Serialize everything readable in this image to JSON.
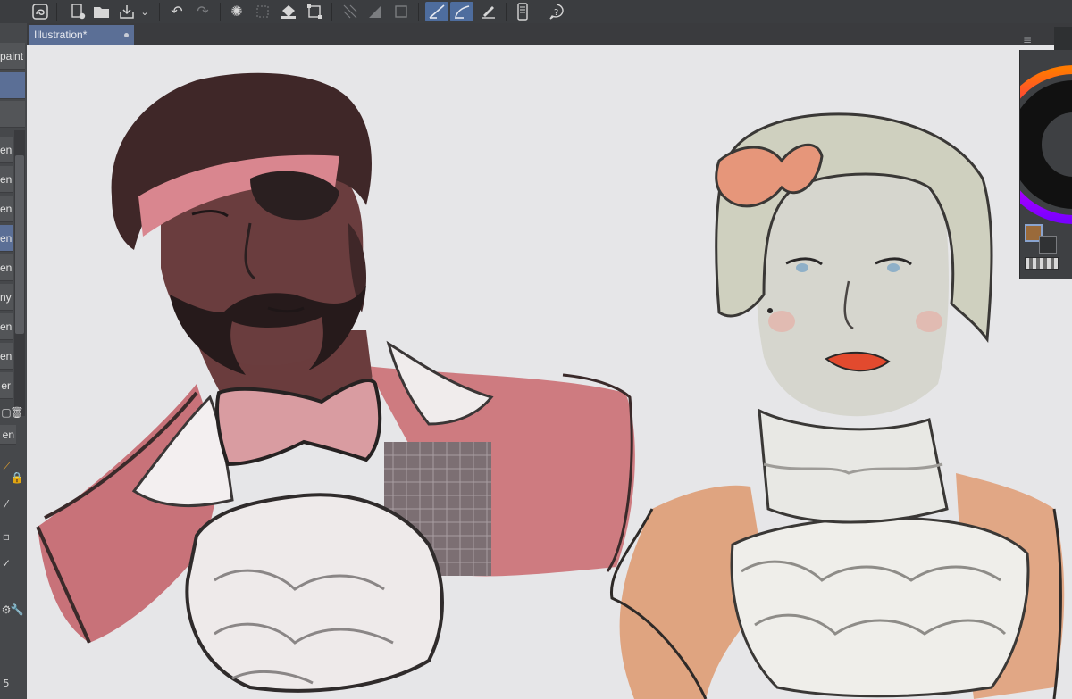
{
  "window": {
    "document_tab": "Illustration*"
  },
  "toolbar": {
    "icons": [
      "app-logo-icon",
      "new-file-icon",
      "open-folder-icon",
      "export-icon",
      "dropdown-chevron-icon",
      "undo-icon",
      "redo-icon",
      "loading-spinner-icon",
      "transform-icon",
      "fill-icon",
      "select-area-icon",
      "show-grid-icon",
      "ruler-icon",
      "snap-icon",
      "snap-ruler-icon",
      "snap-special-ruler-icon",
      "edit-ruler-icon",
      "device-icon",
      "help-icon"
    ]
  },
  "left_panel": {
    "top_labels": [
      "paint"
    ],
    "layers": [
      "en",
      "en",
      "en",
      "en",
      "en",
      "ny",
      "en",
      "en",
      "er"
    ],
    "selected_layer_index": 3,
    "sub_label": "en",
    "bottom_number": "5"
  },
  "canvas": {
    "description_hidden": true
  },
  "color_panel": {
    "main_color": "#9a6a3a",
    "sub_color": "#303234",
    "accent": "#8aa4cf"
  }
}
